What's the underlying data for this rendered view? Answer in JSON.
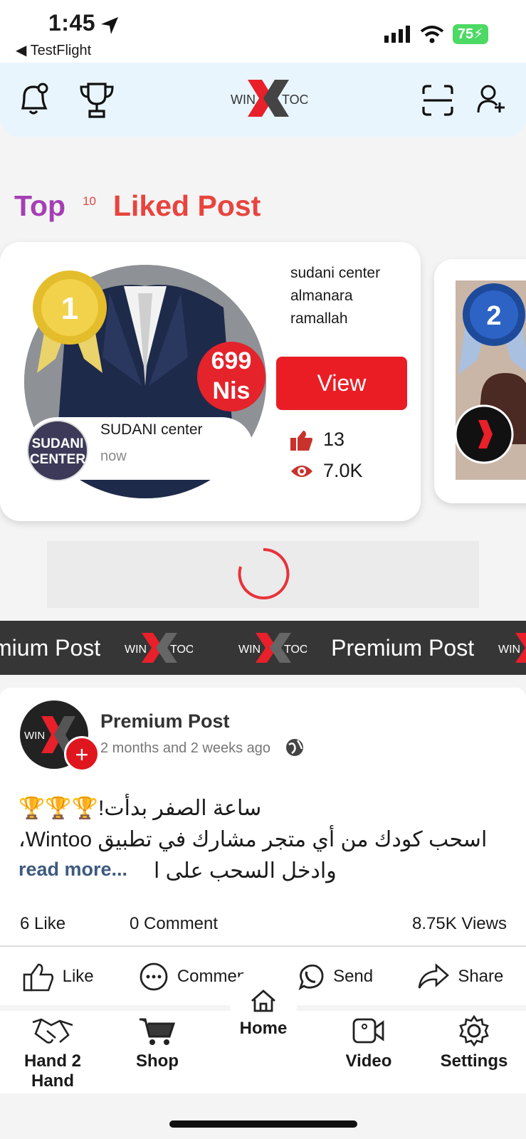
{
  "status_bar": {
    "time": "1:45",
    "back_label": "◀ TestFlight",
    "battery": "75"
  },
  "header": {
    "logo_left": "WIN",
    "logo_right": "TOO"
  },
  "section": {
    "title_top": "Top",
    "title_count": "10",
    "title_rest": "Liked Post"
  },
  "top_post": {
    "rank": "1",
    "price_value": "699",
    "price_unit": "Nis",
    "author_name": "SUDANI center",
    "author_time": "now",
    "author_avatar_line1": "SUDANI",
    "author_avatar_line2": "CENTER",
    "shop_name": "sudani center almanara ramallah",
    "view_label": "View",
    "likes": "13",
    "views": "7.0K"
  },
  "second_post": {
    "rank": "2"
  },
  "ticker": {
    "label": "Premium Post",
    "label_cut": "mium Post",
    "logo_left": "WIN",
    "logo_right": "TOO"
  },
  "post": {
    "title": "Premium Post",
    "time": "2 months and 2 weeks ago",
    "line1": "ساعة الصفر بدأت!🏆🏆🏆",
    "line2": "اسحب كودك من أي متجر مشارك في تطبيق Wintoo،",
    "line3": "وادخل السحب على ا",
    "read_more": "read more...",
    "likes_count": "6 Like",
    "comments_count": "0 Comment",
    "views_count": "8.75K Views"
  },
  "actions": {
    "like": "Like",
    "comment": "Comment",
    "send": "Send",
    "share": "Share"
  },
  "nav": {
    "hand": "Hand 2 Hand",
    "shop": "Shop",
    "home": "Home",
    "video": "Video",
    "settings": "Settings"
  },
  "colors": {
    "accent_red": "#ea1d25",
    "purple": "#a53fb4",
    "header_bg": "#e9f5fd"
  }
}
